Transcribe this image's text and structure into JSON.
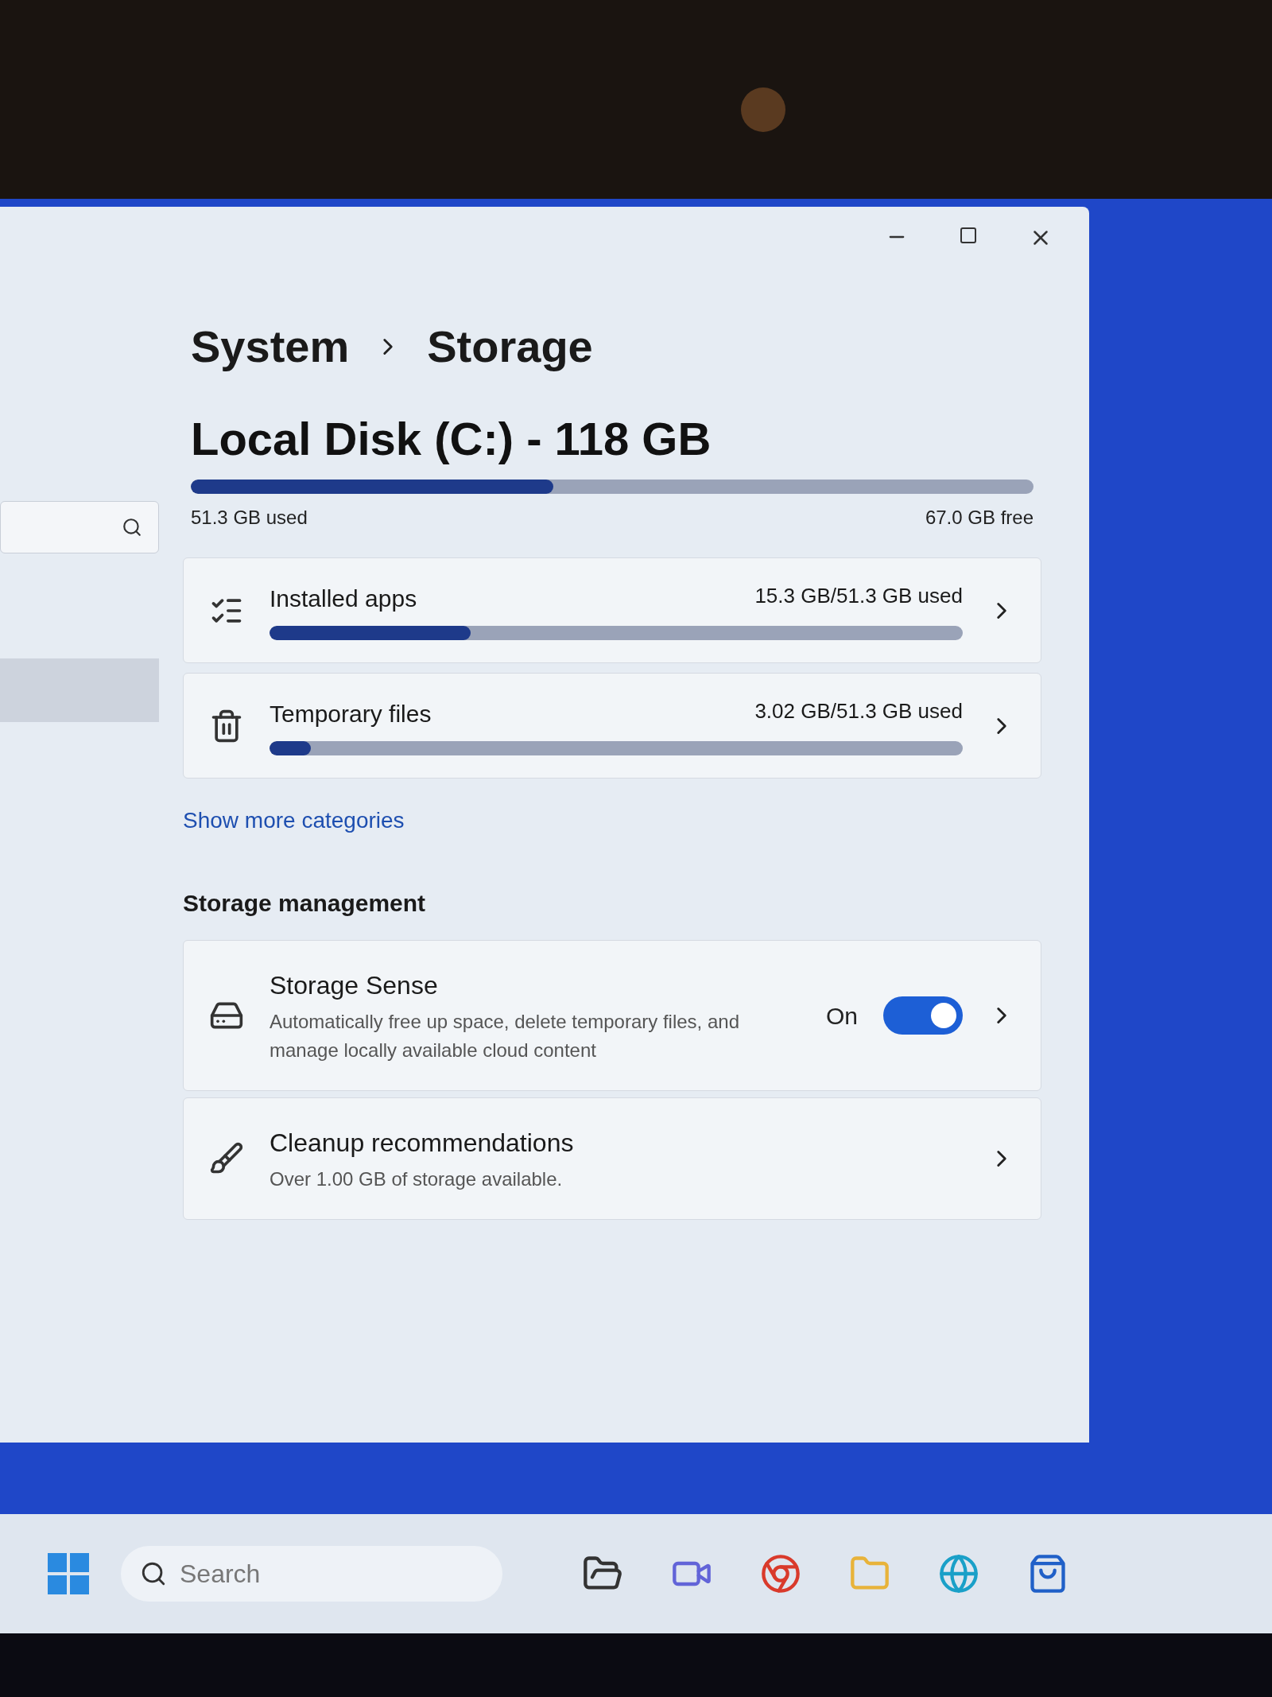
{
  "breadcrumb": [
    {
      "label": "System"
    },
    {
      "label": "Storage"
    }
  ],
  "disk": {
    "title": "Local Disk (C:) - 118 GB",
    "level": 0.43,
    "used": "51.3 GB used",
    "free": "67.0 GB free"
  },
  "categories": [
    {
      "name": "Installed apps",
      "usage": "15.3 GB/51.3 GB used",
      "level": 0.29
    },
    {
      "name": "Temporary files",
      "usage": "3.02 GB/51.3 GB used",
      "level": 0.06
    }
  ],
  "show_more_link": "Show more categories",
  "section_title": "Storage management",
  "management_items": [
    {
      "kind": "toggle",
      "title": "Storage Sense",
      "description": "Automatically free up space, delete temporary files, and manage locally available cloud content",
      "toggle_label": "On",
      "on": true
    },
    {
      "kind": "link",
      "title": "Cleanup recommendations",
      "description": "Over 1.00 GB of storage available."
    }
  ],
  "taskbar": {
    "search_placeholder": "Search"
  }
}
